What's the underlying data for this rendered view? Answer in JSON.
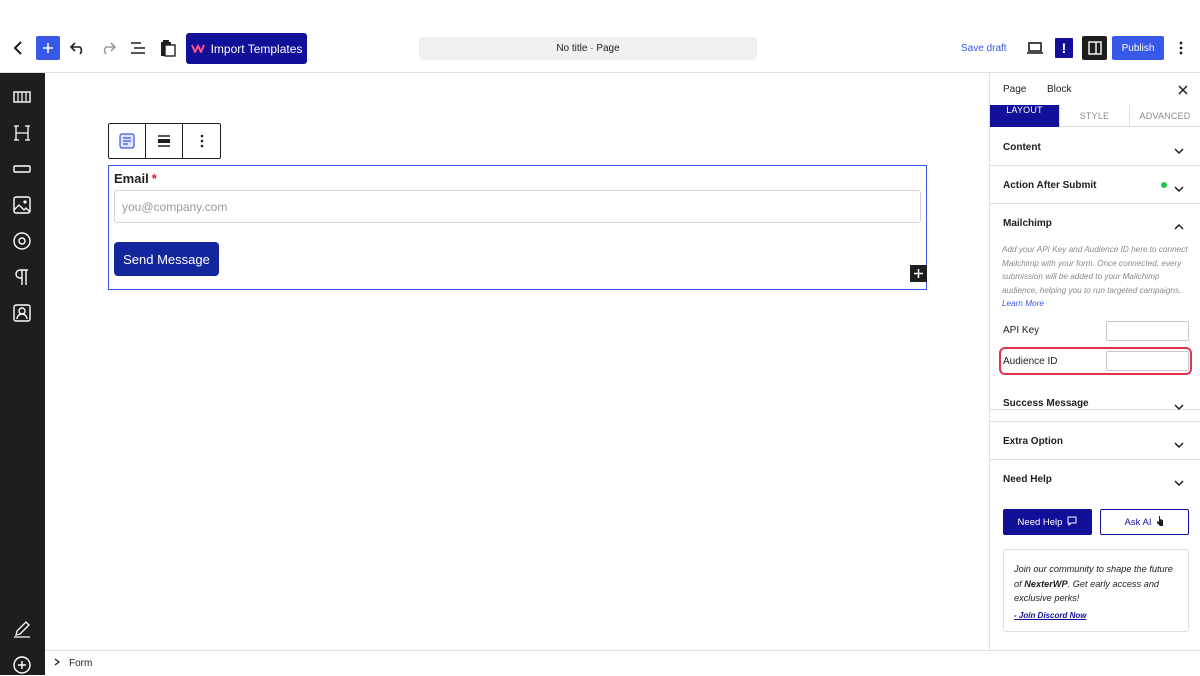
{
  "topbar": {
    "import_label": "Import Templates",
    "doc_title": "No title · Page",
    "save_draft": "Save draft",
    "alert": "!",
    "publish": "Publish"
  },
  "canvas": {
    "email_label": "Email",
    "required_mark": "*",
    "email_placeholder": "you@company.com",
    "send_label": "Send Message"
  },
  "footer": {
    "breadcrumb": "Form"
  },
  "sidebar": {
    "tabs": [
      "Page",
      "Block"
    ],
    "subtabs": [
      "LAYOUT",
      "STYLE",
      "ADVANCED"
    ],
    "sections": {
      "content": "Content",
      "action_after_submit": "Action After Submit",
      "mailchimp": "Mailchimp",
      "success_message": "Success Message",
      "extra_option": "Extra Option",
      "need_help": "Need Help"
    },
    "mailchimp_desc": "Add your API Key and Audience ID here to connect Mailchimp with your form. Once connected, every submission will be added to your Mailchimp audience, helping you to run targeted campaigns.",
    "learn_more": "Learn More",
    "api_key_label": "API Key",
    "api_key_value": "",
    "audience_id_label": "Audience ID",
    "audience_id_value": "",
    "help_button": "Need Help",
    "ask_ai_button": "Ask AI",
    "community_pre": "Join our community to shape the future of ",
    "community_brand": "NexterWP",
    "community_post": ". Get early access and exclusive perks!",
    "discord_link": "- Join Discord Now"
  },
  "colors": {
    "accent": "#3858e9",
    "brand": "#120f99",
    "rail": "#1e1e1e",
    "status_green": "#1dc74b",
    "highlight": "#e0344f"
  }
}
